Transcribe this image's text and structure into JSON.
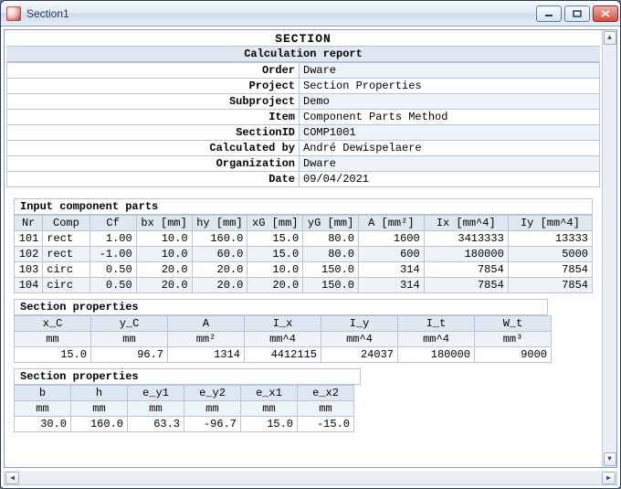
{
  "window": {
    "title": "Section1"
  },
  "report": {
    "heading": "SECTION",
    "subheading": "Calculation report",
    "meta": [
      {
        "label": "Order",
        "value": "Dware"
      },
      {
        "label": "Project",
        "value": "Section Properties"
      },
      {
        "label": "Subproject",
        "value": "Demo"
      },
      {
        "label": "Item",
        "value": "Component Parts Method"
      },
      {
        "label": "SectionID",
        "value": "COMP1001"
      },
      {
        "label": "Calculated by",
        "value": "André Dewispelaere"
      },
      {
        "label": "Organization",
        "value": "Dware"
      },
      {
        "label": "Date",
        "value": "09/04/2021"
      }
    ]
  },
  "parts": {
    "title": "Input component parts",
    "headers": [
      "Nr",
      "Comp",
      "Cf",
      "bx [mm]",
      "hy [mm]",
      "xG [mm]",
      "yG [mm]",
      "A [mm²]",
      "Ix [mm^4]",
      "Iy [mm^4]"
    ],
    "rows": [
      {
        "nr": "101",
        "comp": "rect",
        "cf": "1.00",
        "bx": "10.0",
        "hy": "160.0",
        "xg": "15.0",
        "yg": "80.0",
        "a": "1600",
        "ix": "3413333",
        "iy": "13333"
      },
      {
        "nr": "102",
        "comp": "rect",
        "cf": "-1.00",
        "bx": "10.0",
        "hy": "60.0",
        "xg": "15.0",
        "yg": "80.0",
        "a": "600",
        "ix": "180000",
        "iy": "5000"
      },
      {
        "nr": "103",
        "comp": "circ",
        "cf": "0.50",
        "bx": "20.0",
        "hy": "20.0",
        "xg": "10.0",
        "yg": "150.0",
        "a": "314",
        "ix": "7854",
        "iy": "7854"
      },
      {
        "nr": "104",
        "comp": "circ",
        "cf": "0.50",
        "bx": "20.0",
        "hy": "20.0",
        "xg": "20.0",
        "yg": "150.0",
        "a": "314",
        "ix": "7854",
        "iy": "7854"
      }
    ]
  },
  "props1": {
    "title": "Section properties",
    "headers": [
      "x_C",
      "y_C",
      "A",
      "I_x",
      "I_y",
      "I_t",
      "W_t"
    ],
    "units": [
      "mm",
      "mm",
      "mm²",
      "mm^4",
      "mm^4",
      "mm^4",
      "mm³"
    ],
    "values": [
      "15.0",
      "96.7",
      "1314",
      "4412115",
      "24037",
      "180000",
      "9000"
    ]
  },
  "props2": {
    "title": "Section properties",
    "headers": [
      "b",
      "h",
      "e_y1",
      "e_y2",
      "e_x1",
      "e_x2"
    ],
    "units": [
      "mm",
      "mm",
      "mm",
      "mm",
      "mm",
      "mm"
    ],
    "values": [
      "30.0",
      "160.0",
      "63.3",
      "-96.7",
      "15.0",
      "-15.0"
    ]
  }
}
